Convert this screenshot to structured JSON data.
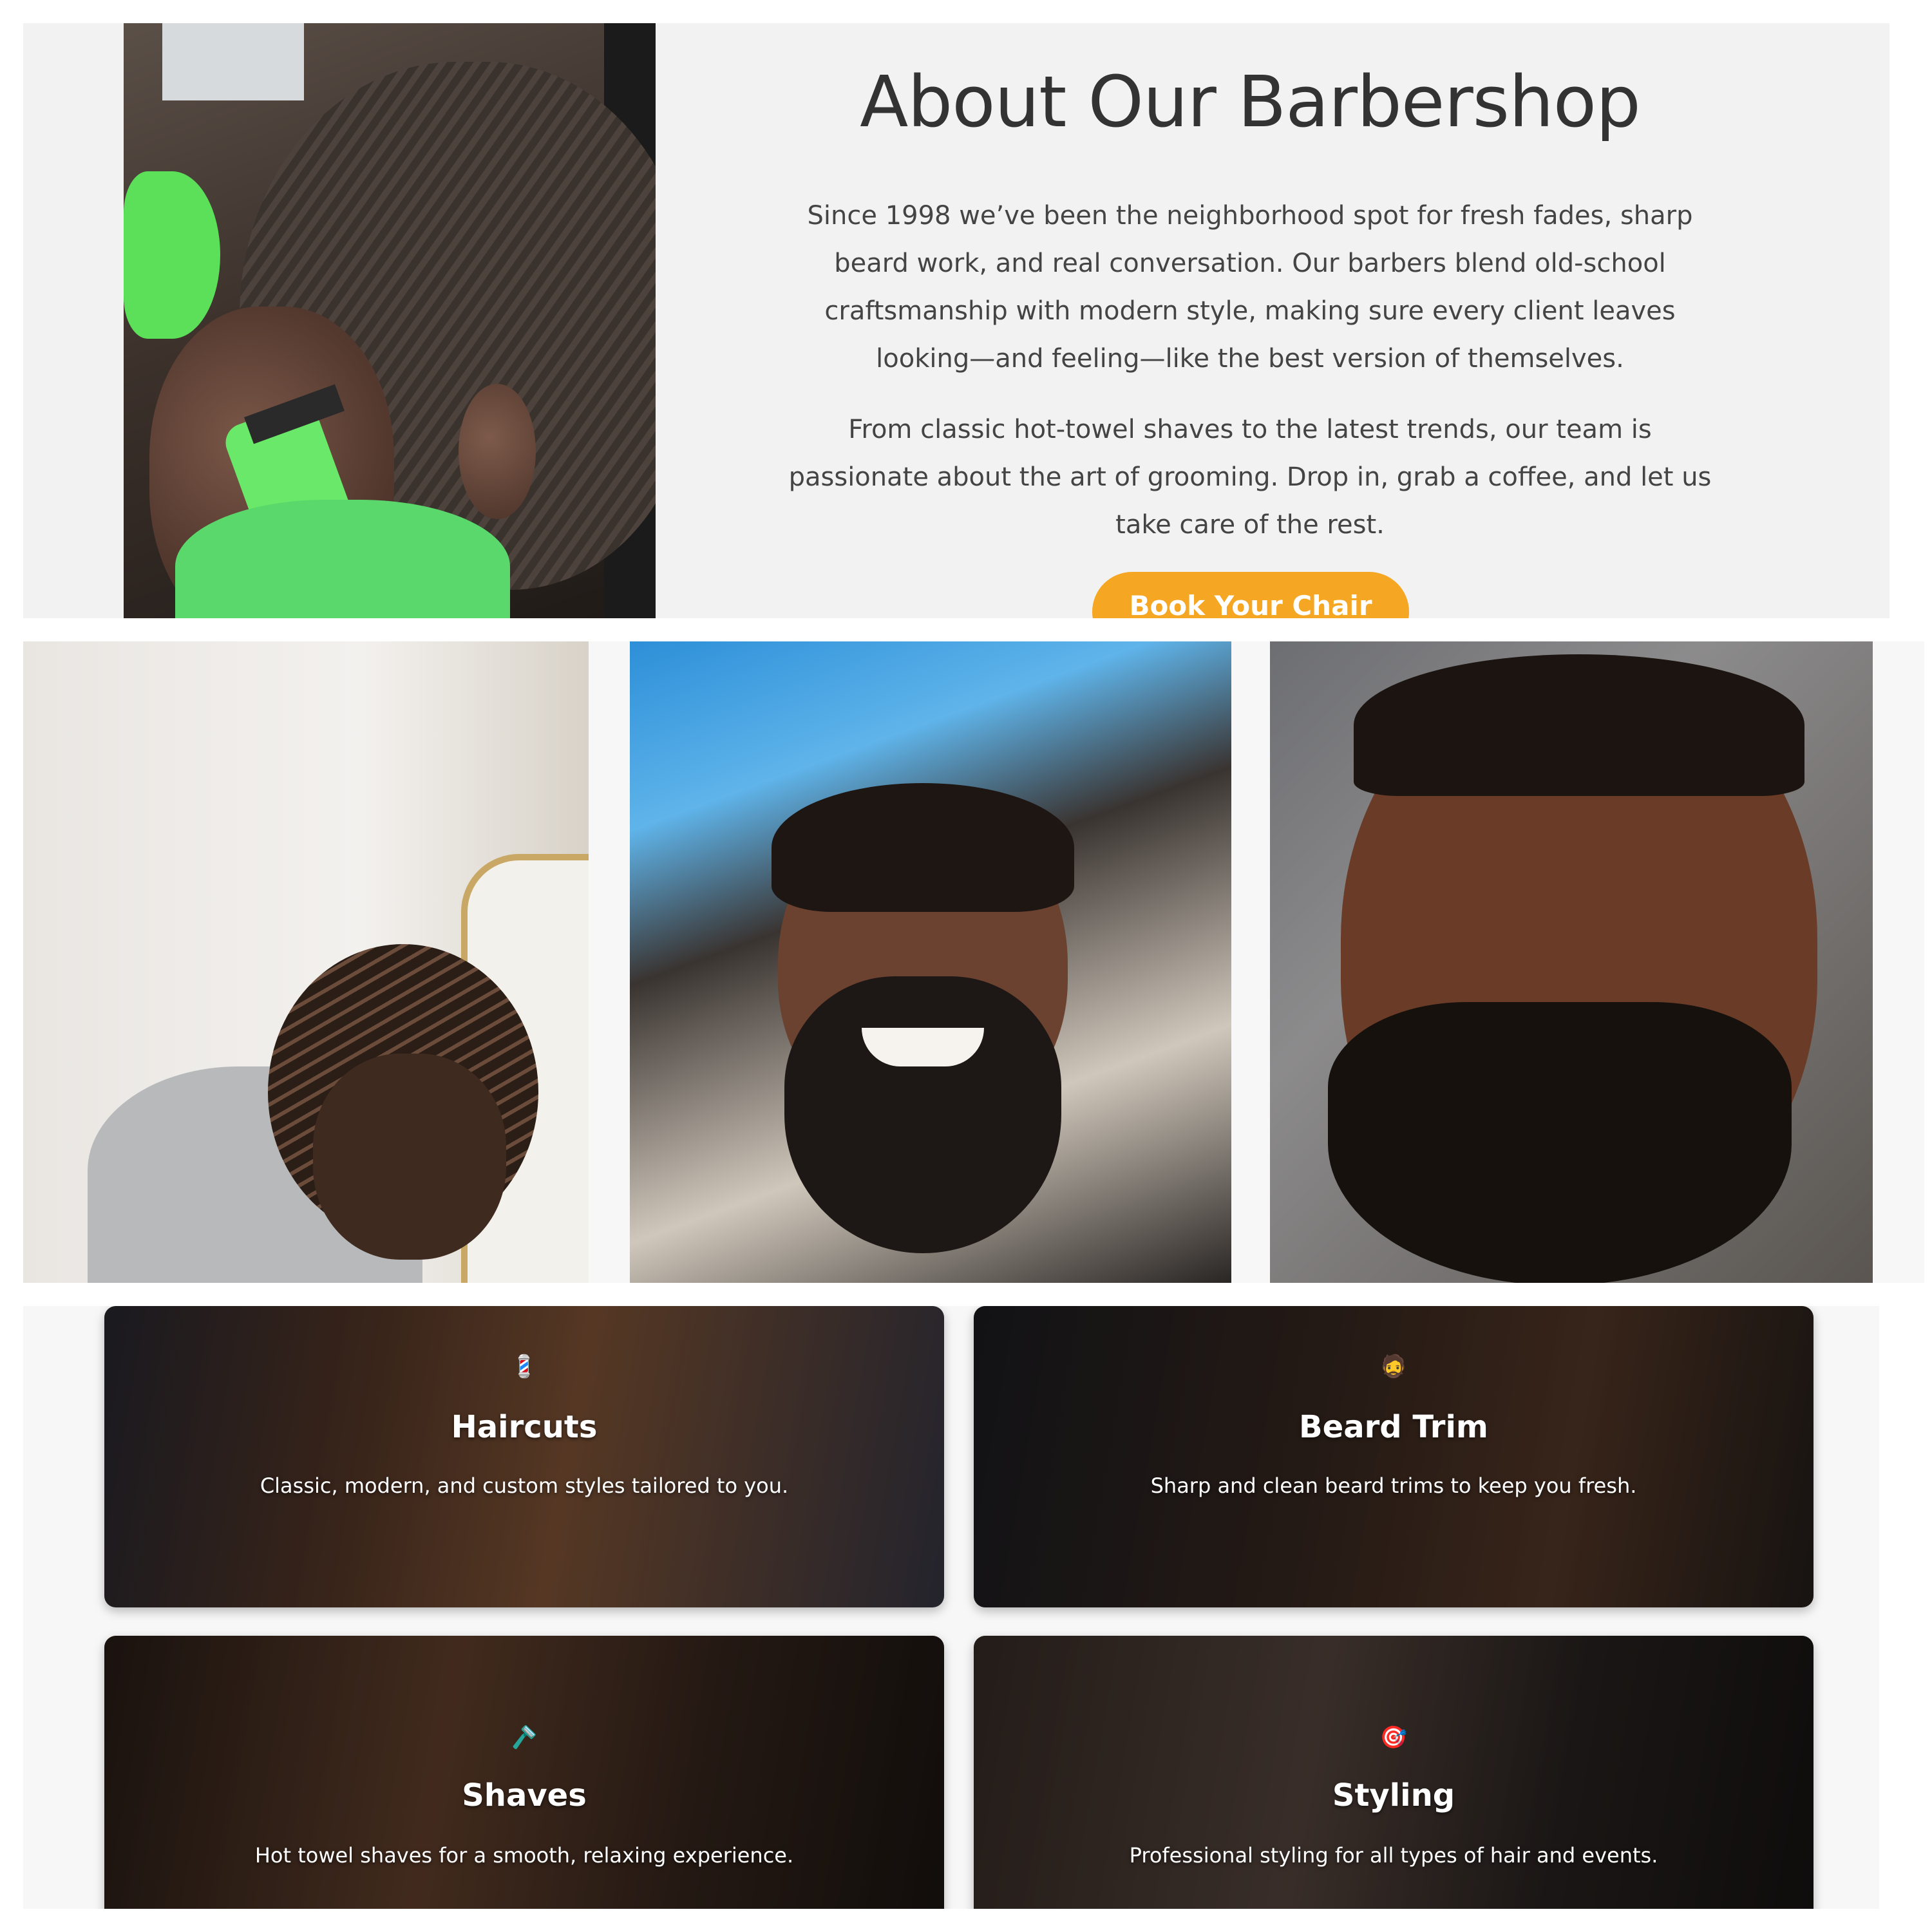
{
  "about": {
    "title": "About Our Barbershop",
    "paragraph1": "Since 1998 we’ve been the neighborhood spot for fresh fades, sharp beard work, and real conversation. Our barbers blend old-school craftsmanship with modern style, making sure every client leaves looking—and feeling—like the best version of themselves.",
    "paragraph2": "From classic hot-towel shaves to the latest trends, our team is passionate about the art of grooming. Drop in, grab a coffee, and let us take care of the rest.",
    "cta_label": "Book Your Chair",
    "accent_color": "#f5a623"
  },
  "services": [
    {
      "icon": "💈",
      "icon_name": "barber-pole-icon",
      "title": "Haircuts",
      "description": "Classic, modern, and custom styles tailored to you."
    },
    {
      "icon": "🧔",
      "icon_name": "bearded-person-icon",
      "title": "Beard Trim",
      "description": "Sharp and clean beard trims to keep you fresh."
    },
    {
      "icon": "🪒",
      "icon_name": "razor-icon",
      "title": "Shaves",
      "description": "Hot towel shaves for a smooth, relaxing experience."
    },
    {
      "icon": "🎯",
      "icon_name": "target-icon",
      "title": "Styling",
      "description": "Professional styling for all types of hair and events."
    }
  ]
}
